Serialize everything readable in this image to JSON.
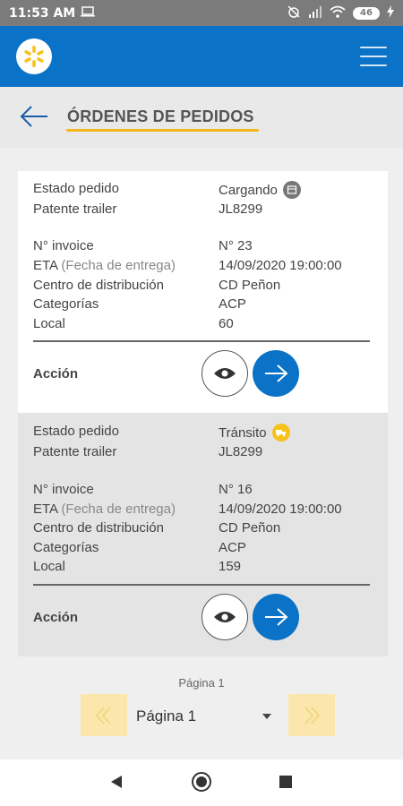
{
  "statusbar": {
    "time": "11:53 AM",
    "battery": "46"
  },
  "header": {
    "title": "ÓRDENES DE PEDIDOS"
  },
  "labels": {
    "estado": "Estado pedido",
    "patente": "Patente trailer",
    "invoice": "N° invoice",
    "eta": "ETA",
    "eta_sub": "(Fecha de entrega)",
    "centro": "Centro de distribución",
    "categorias": "Categorías",
    "local": "Local",
    "accion": "Acción"
  },
  "orders": [
    {
      "estado": "Cargando",
      "estado_icon": "loading-box-icon",
      "patente": "JL8299",
      "invoice": "N° 23",
      "eta": "14/09/2020 19:00:00",
      "centro": "CD Peñon",
      "categorias": "ACP",
      "local": "60"
    },
    {
      "estado": "Tránsito",
      "estado_icon": "truck-icon",
      "patente": "JL8299",
      "invoice": "N° 16",
      "eta": "14/09/2020 19:00:00",
      "centro": "CD Peñon",
      "categorias": "ACP",
      "local": "159"
    }
  ],
  "pagination": {
    "label": "Página 1",
    "selected": "Página 1"
  },
  "colors": {
    "primary": "#0a72c7",
    "accent": "#f7b61c",
    "card_alt": "#e4e4e4"
  }
}
